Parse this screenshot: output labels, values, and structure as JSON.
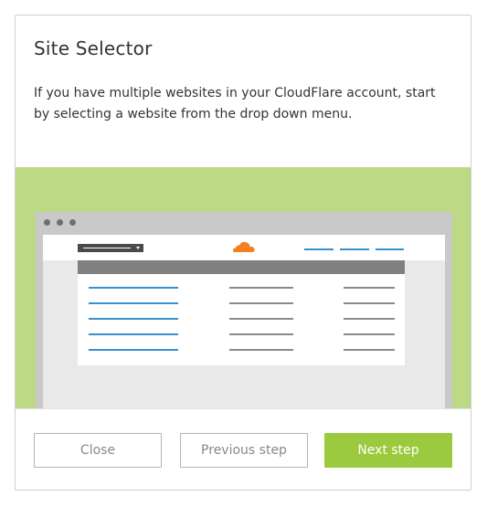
{
  "dialog": {
    "title": "Site Selector",
    "description": "If you have multiple websites in your CloudFlare account, start by selecting a website from the drop down menu."
  },
  "illustration": {
    "background_color": "#bdd985",
    "logo_icon": "cloudflare-cloud-icon",
    "logo_color": "#f38020",
    "link_color": "#3a8fcf"
  },
  "buttons": {
    "close_label": "Close",
    "previous_label": "Previous step",
    "next_label": "Next step",
    "next_color": "#9bca3e"
  }
}
